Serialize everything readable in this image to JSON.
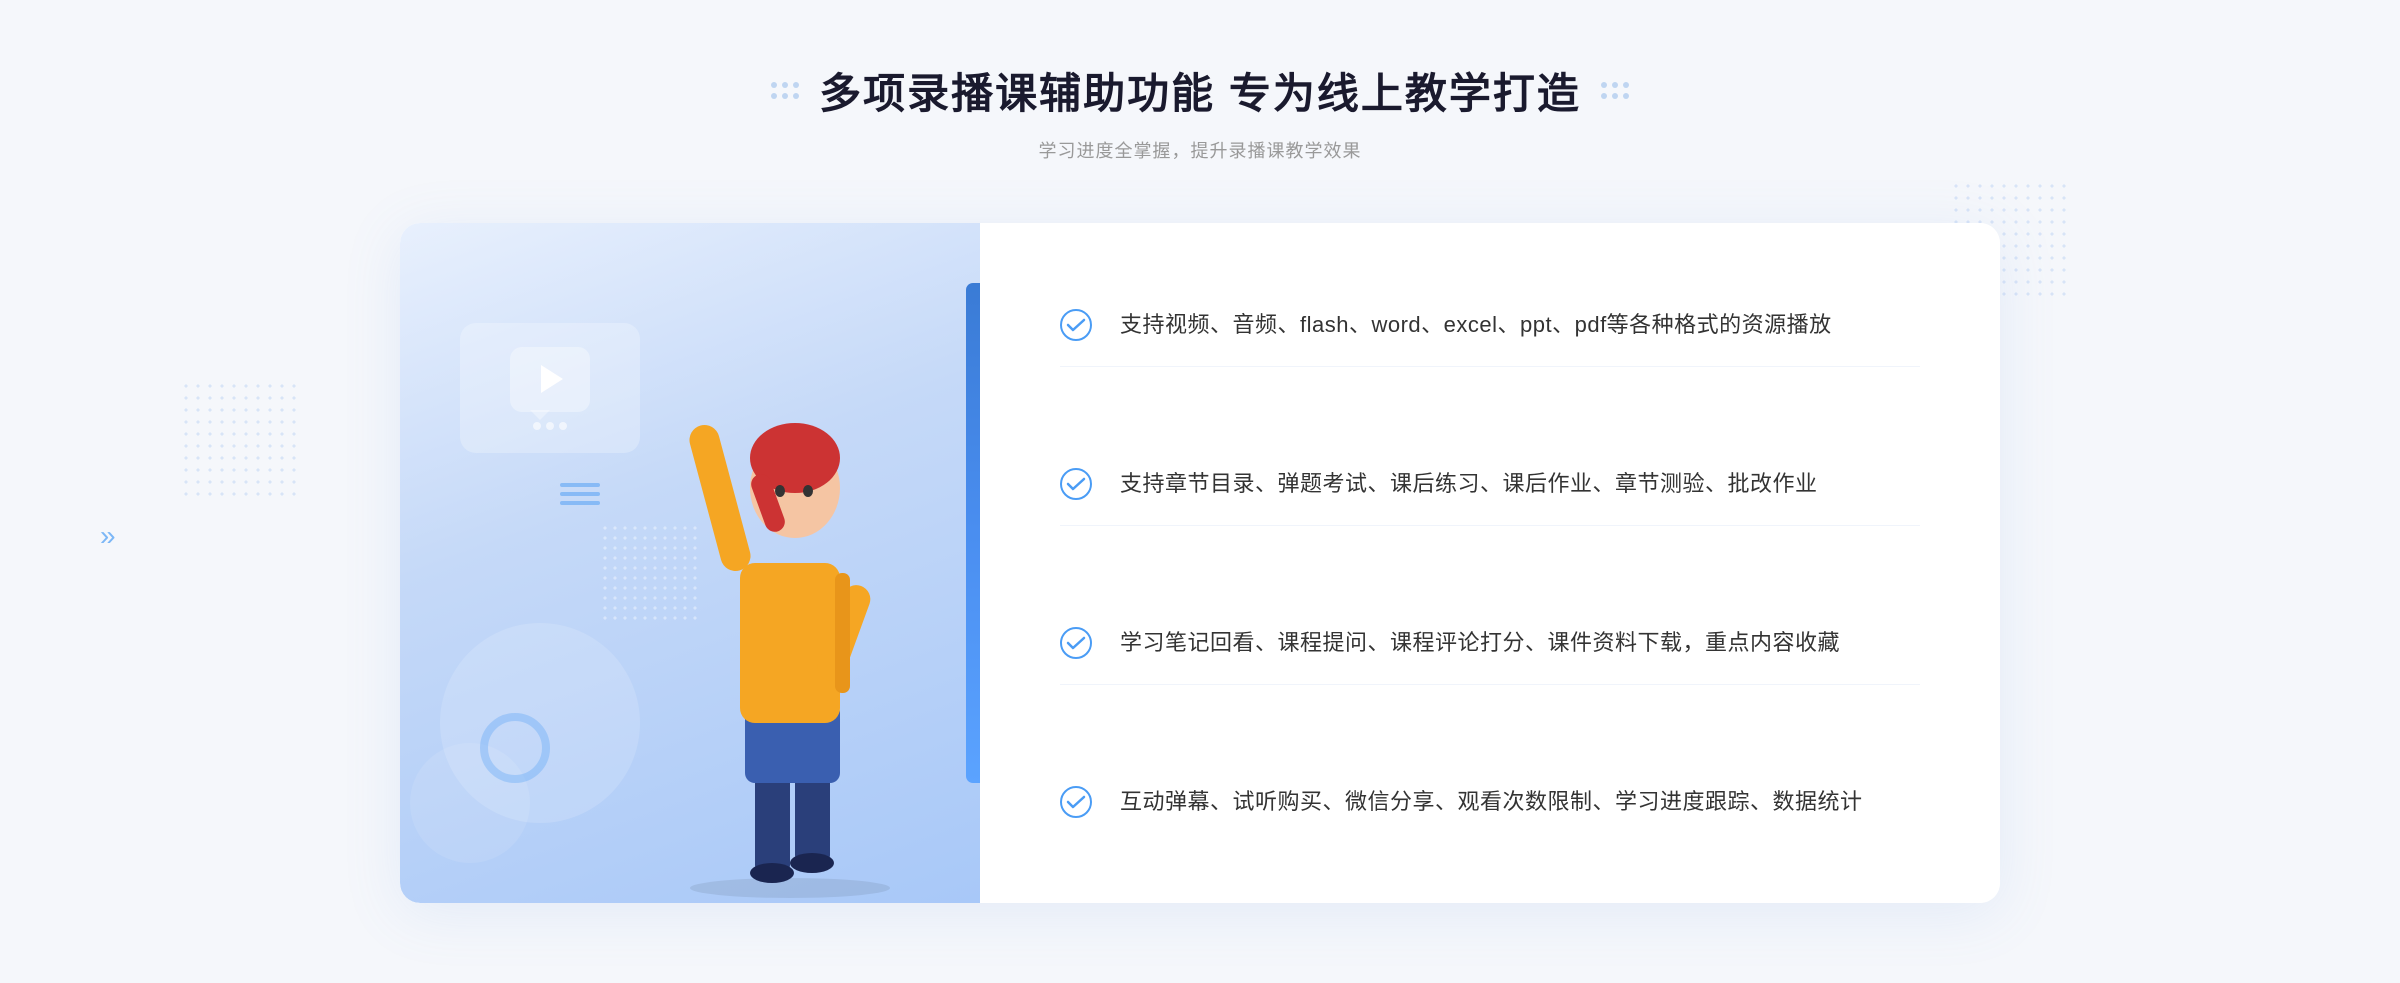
{
  "header": {
    "main_title": "多项录播课辅助功能 专为线上教学打造",
    "sub_title": "学习进度全掌握，提升录播课教学效果"
  },
  "features": [
    {
      "id": 1,
      "text": "支持视频、音频、flash、word、excel、ppt、pdf等各种格式的资源播放"
    },
    {
      "id": 2,
      "text": "支持章节目录、弹题考试、课后练习、课后作业、章节测验、批改作业"
    },
    {
      "id": 3,
      "text": "学习笔记回看、课程提问、课程评论打分、课件资料下载，重点内容收藏"
    },
    {
      "id": 4,
      "text": "互动弹幕、试听购买、微信分享、观看次数限制、学习进度跟踪、数据统计"
    }
  ],
  "icons": {
    "check": "✓",
    "play": "▶",
    "chevron_left": "»"
  },
  "colors": {
    "accent_blue": "#3a7bd5",
    "light_blue": "#4a9cf5",
    "text_dark": "#1a1a2e",
    "text_gray": "#999999",
    "text_feature": "#333333"
  }
}
